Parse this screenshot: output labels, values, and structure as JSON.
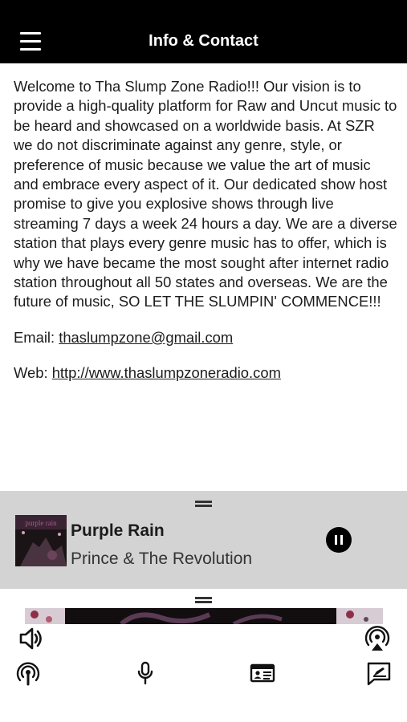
{
  "header": {
    "title": "Info & Contact",
    "menu_icon": "hamburger-icon"
  },
  "about": {
    "paragraph": "Welcome to Tha Slump Zone Radio!!! Our vision is to provide a high-quality platform for Raw and Uncut music to be heard and showcased on a worldwide basis. At SZR we do not discriminate against any genre, style, or preference of music because we value the art of music and embrace every aspect of it. Our dedicated show host promise to give you explosive shows through live streaming 7 days a week 24 hours a day. We are a diverse station that plays every genre music has to offer, which is why we have became the most sought after internet radio station throughout all 50 states and overseas. We are the future of music, SO LET THE SLUMPIN' COMMENCE!!!",
    "email_label": "Email: ",
    "email": "thaslumpzone@gmail.com",
    "web_label": "Web: ",
    "web": "http://www.thaslumpzoneradio.com"
  },
  "player": {
    "song": "Purple Rain",
    "artist": "Prince & The Revolution",
    "state": "playing",
    "control_icon": "pause-icon"
  },
  "bottom_icons": {
    "top_left": "volume-icon",
    "top_right": "airplay-icon",
    "row": [
      "podcast-icon",
      "microphone-icon",
      "contact-card-icon",
      "message-edit-icon"
    ]
  },
  "colors": {
    "header_bg": "#000000",
    "player_bg": "#d3d3d3",
    "text": "#1c1c1c"
  }
}
